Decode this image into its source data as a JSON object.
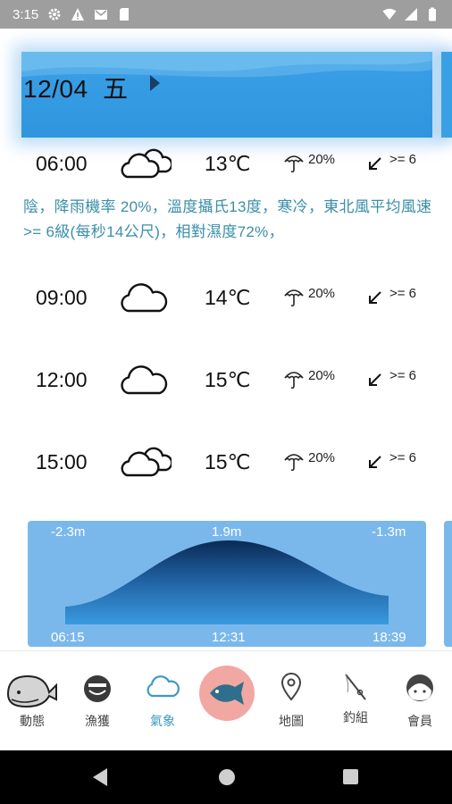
{
  "status": {
    "time": "3:15",
    "icons": [
      "gear-icon",
      "warning-icon",
      "gmail-icon",
      "sd-card-icon",
      "wifi-icon",
      "signal-icon",
      "battery-icon"
    ]
  },
  "header": {
    "date": "12/04",
    "weekday": "五"
  },
  "forecast": [
    {
      "time": "06:00",
      "icon": "partly-cloudy-icon",
      "temp": "13℃",
      "rain": "20%",
      "wind": ">= 6"
    },
    {
      "time": "09:00",
      "icon": "cloud-icon",
      "temp": "14℃",
      "rain": "20%",
      "wind": ">= 6"
    },
    {
      "time": "12:00",
      "icon": "cloud-icon",
      "temp": "15℃",
      "rain": "20%",
      "wind": ">= 6"
    },
    {
      "time": "15:00",
      "icon": "partly-cloudy-icon",
      "temp": "15℃",
      "rain": "20%",
      "wind": ">= 6"
    }
  ],
  "description": "陰，降雨機率 20%，溫度攝氏13度，寒冷，東北風平均風速>= 6級(每秒14公尺)，相對濕度72%，",
  "tide": {
    "low1": "-2.3m",
    "high": "1.9m",
    "low2": "-1.3m",
    "t1": "06:15",
    "t2": "12:31",
    "t3": "18:39"
  },
  "nav": {
    "items": [
      {
        "label": "動態",
        "icon": "whale-icon"
      },
      {
        "label": "漁獲",
        "icon": "fish-basket-icon"
      },
      {
        "label": "氣象",
        "icon": "cloud-icon"
      },
      {
        "label": "",
        "icon": "fish-icon"
      },
      {
        "label": "地圖",
        "icon": "map-pin-icon"
      },
      {
        "label": "釣組",
        "icon": "fishing-rod-icon"
      },
      {
        "label": "會員",
        "icon": "member-icon"
      }
    ],
    "active": "氣象"
  },
  "colors": {
    "banner": "#3aa0e6",
    "tide_card": "#7ab8ec",
    "description": "#3a8fa8",
    "fab": "#f2a8a2",
    "active_nav": "#3a9ac4"
  }
}
